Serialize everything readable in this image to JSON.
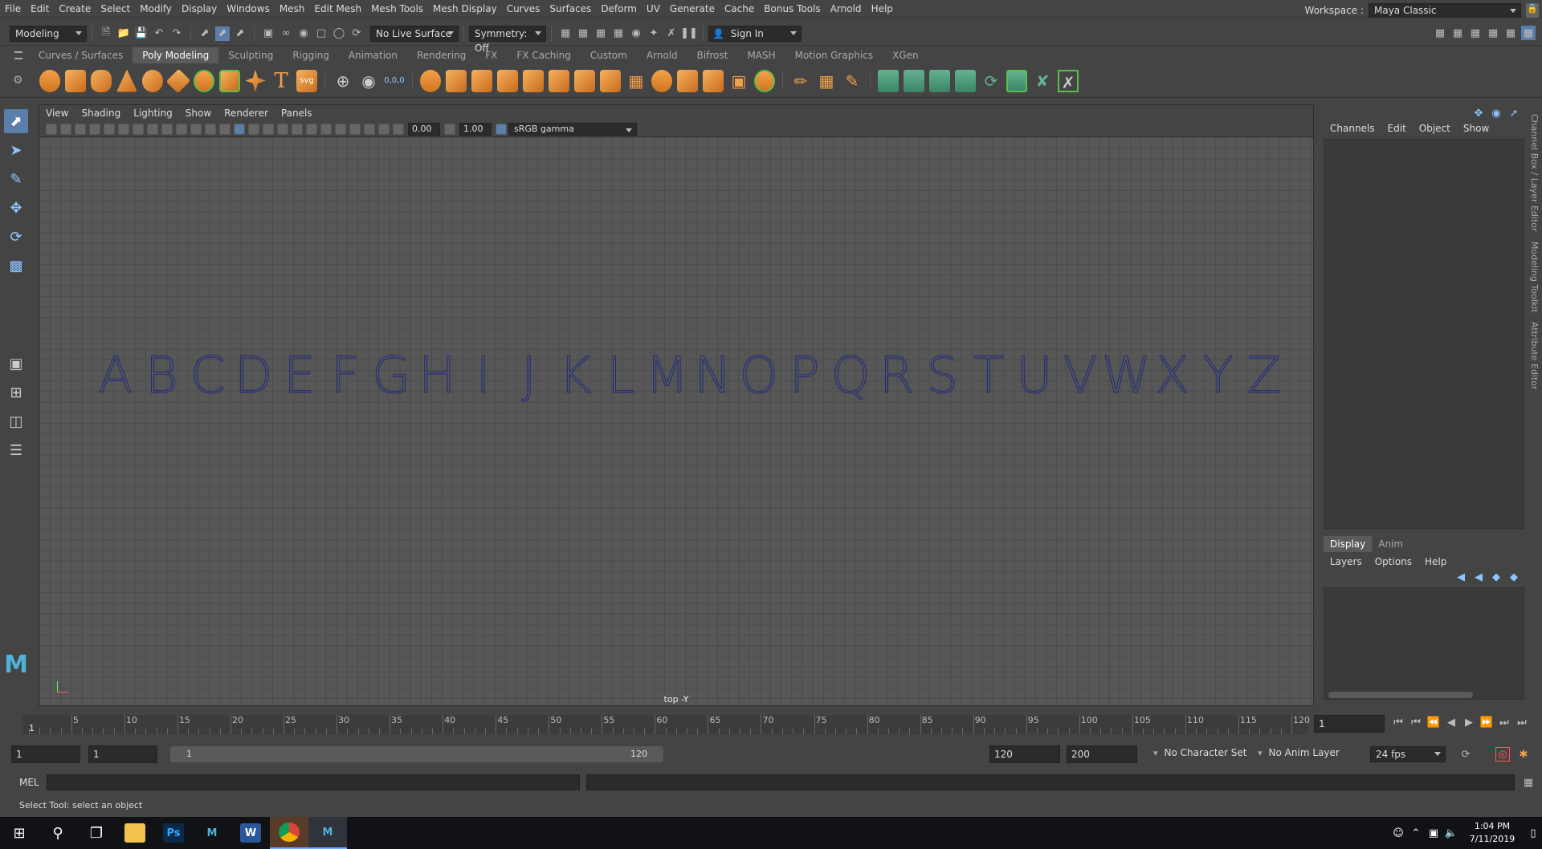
{
  "menu": [
    "File",
    "Edit",
    "Create",
    "Select",
    "Modify",
    "Display",
    "Windows",
    "Mesh",
    "Edit Mesh",
    "Mesh Tools",
    "Mesh Display",
    "Curves",
    "Surfaces",
    "Deform",
    "UV",
    "Generate",
    "Cache",
    "Bonus Tools",
    "Arnold",
    "Help"
  ],
  "workspace": {
    "label": "Workspace :",
    "value": "Maya Classic"
  },
  "status": {
    "mode": "Modeling",
    "live_surface": "No Live Surface",
    "symmetry": "Symmetry: Off",
    "sign_in": "Sign In"
  },
  "shelf_tabs": [
    "Curves / Surfaces",
    "Poly Modeling",
    "Sculpting",
    "Rigging",
    "Animation",
    "Rendering",
    "FX",
    "FX Caching",
    "Custom",
    "Arnold",
    "Bifrost",
    "MASH",
    "Motion Graphics",
    "XGen"
  ],
  "shelf_active": "Poly Modeling",
  "shelf_icons": {
    "text_tool": "T",
    "svg_tool": "svg",
    "coords": "0,0,0"
  },
  "viewport": {
    "menu": [
      "View",
      "Shading",
      "Lighting",
      "Show",
      "Renderer",
      "Panels"
    ],
    "field1": "0.00",
    "field2": "1.00",
    "colorspace": "sRGB gamma",
    "camera_label": "top -Y",
    "letters": "ABCDEFGHIJKLMNOPQRSTUVWXYZ"
  },
  "channelbox": {
    "menu": [
      "Channels",
      "Edit",
      "Object",
      "Show"
    ]
  },
  "layereditor": {
    "tabs": [
      "Display",
      "Anim"
    ],
    "menu": [
      "Layers",
      "Options",
      "Help"
    ]
  },
  "sidetabs": [
    "Channel Box / Layer Editor",
    "Modeling Toolkit",
    "Attribute Editor"
  ],
  "timeline": {
    "ticks": [
      "5",
      "10",
      "15",
      "20",
      "25",
      "30",
      "35",
      "40",
      "45",
      "50",
      "55",
      "60",
      "65",
      "70",
      "75",
      "80",
      "85",
      "90",
      "95",
      "100",
      "105",
      "110",
      "115",
      "120"
    ],
    "start_marker": "1",
    "current": "1"
  },
  "range": {
    "start": "1",
    "playback_start": "1",
    "slider_start": "1",
    "slider_end": "120",
    "playback_end": "120",
    "end": "200",
    "character_set": "No Character Set",
    "anim_layer": "No Anim Layer",
    "fps": "24 fps"
  },
  "cmd": {
    "lang": "MEL"
  },
  "help": "Select Tool: select an object",
  "clock": {
    "time": "1:04 PM",
    "date": "7/11/2019"
  }
}
